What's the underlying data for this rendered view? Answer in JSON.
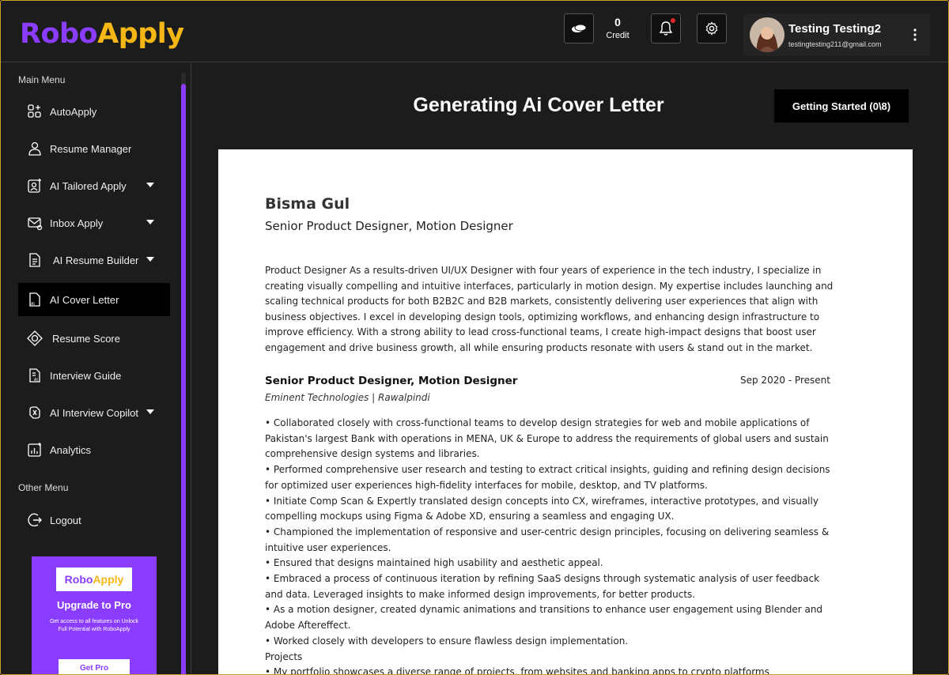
{
  "brand": {
    "part1": "Robo",
    "part2": "Apply",
    "color1": "#8b3dff",
    "color2": "#f5b715"
  },
  "header": {
    "credit_value": "0",
    "credit_label": "Credit",
    "user_name": "Testing Testing2",
    "user_email": "testingtesting211@gmail.com"
  },
  "sidebar": {
    "main_heading": "Main Menu",
    "items": [
      {
        "label": "AutoApply",
        "icon": "autoapply-icon"
      },
      {
        "label": "Resume Manager",
        "icon": "user-icon"
      },
      {
        "label": "AI Tailored Apply",
        "icon": "tailored-apply-icon"
      },
      {
        "label": "Inbox Apply",
        "icon": "inbox-icon"
      },
      {
        "label": "AI Resume Builder",
        "icon": "document-icon"
      },
      {
        "label": "AI Cover Letter",
        "icon": "cover-letter-icon"
      },
      {
        "label": "Resume Score",
        "icon": "score-icon"
      },
      {
        "label": "Interview Guide",
        "icon": "guide-icon"
      },
      {
        "label": "AI Interview Copilot",
        "icon": "copilot-icon"
      },
      {
        "label": "Analytics",
        "icon": "analytics-icon"
      }
    ],
    "other_heading": "Other Menu",
    "logout_label": "Logout"
  },
  "promo": {
    "title": "Upgrade to Pro",
    "text": "Get access to all features on Unlock Full Potential with RoboApply",
    "button": "Get Pro"
  },
  "main": {
    "title": "Generating Ai Cover Letter",
    "getting_started": "Getting Started (0\\8)"
  },
  "document": {
    "name": "Bisma Gul",
    "role": "Senior Product Designer, Motion Designer",
    "summary": "Product Designer As a results-driven UI/UX Designer with four years of experience in the tech industry, I specialize in creating visually compelling and intuitive interfaces, particularly in motion design. My expertise includes launching and scaling technical products for both B2B2C and B2B markets, consistently delivering user experiences that align with business objectives. I excel in developing design tools, optimizing workflows, and enhancing design infrastructure to improve efficiency. With a strong ability to lead cross-functional teams, I create high-impact designs that boost user engagement and drive business growth, all while ensuring products resonate with users & stand out in the market.",
    "job_title": "Senior Product Designer, Motion Designer",
    "job_date": "Sep 2020 - Present",
    "job_company": "Eminent Technologies | Rawalpindi",
    "bullets": [
      "  •  Collaborated closely with cross-functional teams to develop design strategies for web and mobile applications of Pakistan's largest Bank with operations in MENA, UK & Europe to address the requirements of global users and sustain comprehensive design systems and libraries.",
      "  •  Performed comprehensive user research and testing to extract critical insights, guiding and refining design decisions for optimized user experiences high-fidelity interfaces for mobile, desktop, and TV platforms.",
      "  •  Initiate Comp Scan & Expertly translated design concepts into CX, wireframes, interactive prototypes, and visually compelling mockups using Figma & Adobe XD, ensuring a seamless and engaging UX.",
      "  •  Championed the implementation of responsive and user-centric design principles, focusing on delivering seamless & intuitive user experiences.",
      "  •  Ensured that designs maintained high usability and aesthetic appeal.",
      "  •  Embraced a process of continuous iteration by refining SaaS designs through systematic analysis of user feedback and data. Leveraged insights to make informed design improvements, for better products.",
      "  •  As a motion designer, created dynamic animations and transitions to enhance user engagement using Blender and Adobe Aftereffect.",
      "  •  Worked closely with developers to ensure flawless design implementation.",
      "Projects",
      "  •  My portfolio showcases a diverse range of projects, from websites and banking apps to crypto platforms"
    ]
  }
}
